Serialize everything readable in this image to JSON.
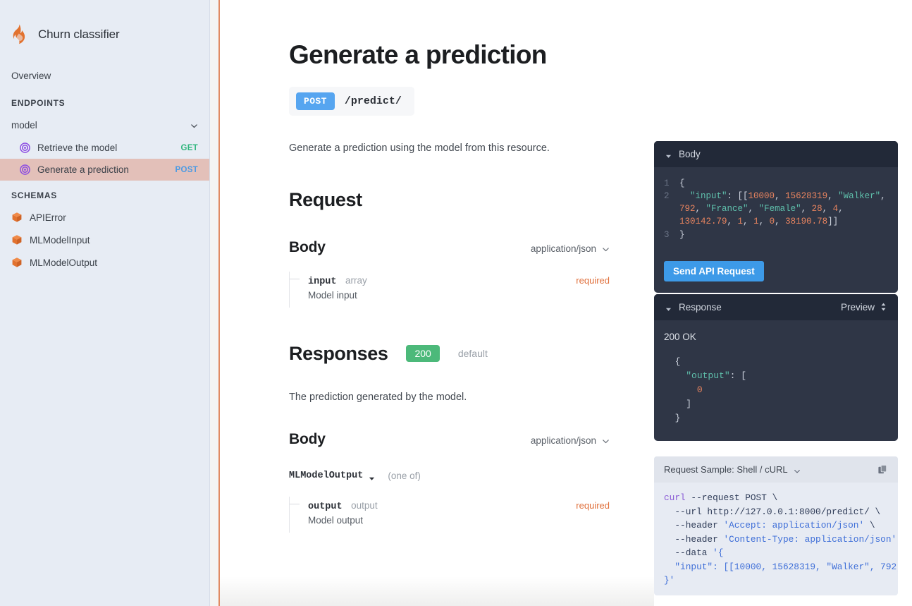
{
  "sidebar": {
    "logo_icon": "flame-icon",
    "title": "Churn classifier",
    "overview_label": "Overview",
    "endpoints_heading": "ENDPOINTS",
    "group_label": "model",
    "group_chevron_icon": "chevron-down-icon",
    "endpoints": [
      {
        "icon": "target-icon",
        "label": "Retrieve the model",
        "method": "GET",
        "active": false
      },
      {
        "icon": "target-icon",
        "label": "Generate a prediction",
        "method": "POST",
        "active": true
      }
    ],
    "schemas_heading": "SCHEMAS",
    "schemas": [
      {
        "icon": "cube-icon",
        "label": "APIError"
      },
      {
        "icon": "cube-icon",
        "label": "MLModelInput"
      },
      {
        "icon": "cube-icon",
        "label": "MLModelOutput"
      }
    ]
  },
  "main": {
    "page_title": "Generate a prediction",
    "method_badge": "POST",
    "path": "/predict/",
    "description": "Generate a prediction using the model from this resource.",
    "request": {
      "heading": "Request",
      "body_heading": "Body",
      "mime": "application/json",
      "mime_chevron_icon": "chevron-down-icon",
      "properties": [
        {
          "name": "input",
          "type": "array",
          "required": "required",
          "description": "Model input"
        }
      ]
    },
    "responses": {
      "heading": "Responses",
      "status_badge": "200",
      "status_default": "default",
      "description": "The prediction generated by the model.",
      "body_heading": "Body",
      "mime": "application/json",
      "mime_chevron_icon": "chevron-down-icon",
      "schema_name": "MLModelOutput",
      "schema_caret_icon": "caret-down-icon",
      "schema_note": "(one of)",
      "properties": [
        {
          "name": "output",
          "type": "output",
          "required": "required",
          "description": "Model output"
        }
      ]
    }
  },
  "right_panel": {
    "body_card": {
      "title": "Body",
      "collapse_icon": "triangle-down-icon",
      "line_numbers": [
        "1",
        "2",
        "3"
      ],
      "lines": [
        {
          "n": "1",
          "segments": [
            {
              "t": "{",
              "c": "punc"
            }
          ]
        },
        {
          "n": "2",
          "segments": [
            {
              "t": "  ",
              "c": "punc"
            },
            {
              "t": "\"input\"",
              "c": "key"
            },
            {
              "t": ": [[",
              "c": "punc"
            },
            {
              "t": "10000",
              "c": "num"
            },
            {
              "t": ", ",
              "c": "punc"
            },
            {
              "t": "15628319",
              "c": "num"
            },
            {
              "t": ", ",
              "c": "punc"
            },
            {
              "t": "\"Walker\"",
              "c": "str"
            },
            {
              "t": ", ",
              "c": "punc"
            },
            {
              "t": "792",
              "c": "num"
            },
            {
              "t": ", ",
              "c": "punc"
            },
            {
              "t": "\"France\"",
              "c": "str"
            },
            {
              "t": ", ",
              "c": "punc"
            },
            {
              "t": "\"Female\"",
              "c": "str"
            },
            {
              "t": ", ",
              "c": "punc"
            },
            {
              "t": "28",
              "c": "num"
            },
            {
              "t": ", ",
              "c": "punc"
            },
            {
              "t": "4",
              "c": "num"
            },
            {
              "t": ", ",
              "c": "punc"
            },
            {
              "t": "130142.79",
              "c": "num"
            },
            {
              "t": ", ",
              "c": "punc"
            },
            {
              "t": "1",
              "c": "num"
            },
            {
              "t": ", ",
              "c": "punc"
            },
            {
              "t": "1",
              "c": "num"
            },
            {
              "t": ", ",
              "c": "punc"
            },
            {
              "t": "0",
              "c": "num"
            },
            {
              "t": ", ",
              "c": "punc"
            },
            {
              "t": "38190.78",
              "c": "num"
            },
            {
              "t": "]]",
              "c": "punc"
            }
          ]
        },
        {
          "n": "3",
          "segments": [
            {
              "t": "}",
              "c": "punc"
            }
          ]
        }
      ],
      "send_button": "Send API Request"
    },
    "response_card": {
      "title": "Response",
      "collapse_icon": "triangle-down-icon",
      "mode_label": "Preview",
      "mode_icon": "up-down-arrows-icon",
      "status": "200 OK",
      "body_lines": [
        {
          "segments": [
            {
              "t": "  {",
              "c": "punc"
            }
          ]
        },
        {
          "segments": [
            {
              "t": "    ",
              "c": "punc"
            },
            {
              "t": "\"output\"",
              "c": "key"
            },
            {
              "t": ": [",
              "c": "punc"
            }
          ]
        },
        {
          "segments": [
            {
              "t": "      ",
              "c": "punc"
            },
            {
              "t": "0",
              "c": "num"
            }
          ]
        },
        {
          "segments": [
            {
              "t": "    ]",
              "c": "punc"
            }
          ]
        },
        {
          "segments": [
            {
              "t": "  }",
              "c": "punc"
            }
          ]
        }
      ]
    },
    "sample_card": {
      "title": "Request Sample: Shell / cURL",
      "chevron_icon": "chevron-down-icon",
      "copy_icon": "copy-icon",
      "lines": [
        {
          "segments": [
            {
              "t": "curl",
              "c": "cmd"
            },
            {
              "t": " --request POST \\",
              "c": "plain"
            }
          ]
        },
        {
          "segments": [
            {
              "t": "  --url http://127.0.0.1:8000/predict/ \\",
              "c": "plain"
            }
          ]
        },
        {
          "segments": [
            {
              "t": "  --header ",
              "c": "plain"
            },
            {
              "t": "'Accept: application/json'",
              "c": "str"
            },
            {
              "t": " \\",
              "c": "plain"
            }
          ]
        },
        {
          "segments": [
            {
              "t": "  --header ",
              "c": "plain"
            },
            {
              "t": "'Content-Type: application/json'",
              "c": "str"
            },
            {
              "t": " \\",
              "c": "plain"
            }
          ]
        },
        {
          "segments": [
            {
              "t": "  --data ",
              "c": "plain"
            },
            {
              "t": "'{",
              "c": "str"
            }
          ]
        },
        {
          "segments": [
            {
              "t": "  \"input\": [[10000, 15628319, \"Walker\", 792,",
              "c": "str"
            }
          ]
        },
        {
          "segments": [
            {
              "t": "}'",
              "c": "str"
            }
          ]
        }
      ]
    }
  },
  "colors": {
    "sidebar_bg": "#e7ecf4",
    "active_item_bg": "#e3c0b9",
    "accent_rule": "#e08a62",
    "method_post": "#56a5f0",
    "method_get": "#2fb67c",
    "status_200": "#4cb97a",
    "required": "#e0703c",
    "dark_panel": "#2f3646",
    "dark_panel_head": "#222938",
    "send_button": "#3d9ae8",
    "code_key": "#5fc0ac",
    "code_number": "#e8845f",
    "schema_icon": "#e2722f",
    "endpoint_icon": "#8b4ae2"
  }
}
